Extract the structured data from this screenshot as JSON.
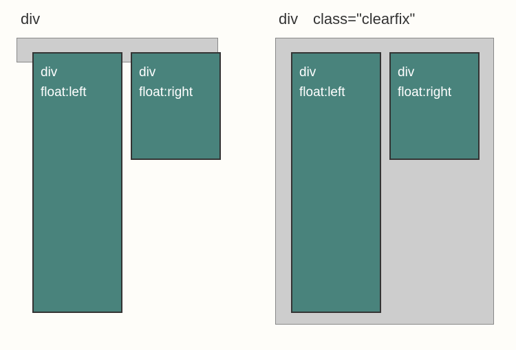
{
  "left": {
    "header": "div",
    "box_left_line1": "div",
    "box_left_line2": "float:left",
    "box_right_line1": "div",
    "box_right_line2": "float:right"
  },
  "right": {
    "header1": "div",
    "header2": "class=\"clearfix\"",
    "box_left_line1": "div",
    "box_left_line2": "float:left",
    "box_right_line1": "div",
    "box_right_line2": "float:right"
  }
}
